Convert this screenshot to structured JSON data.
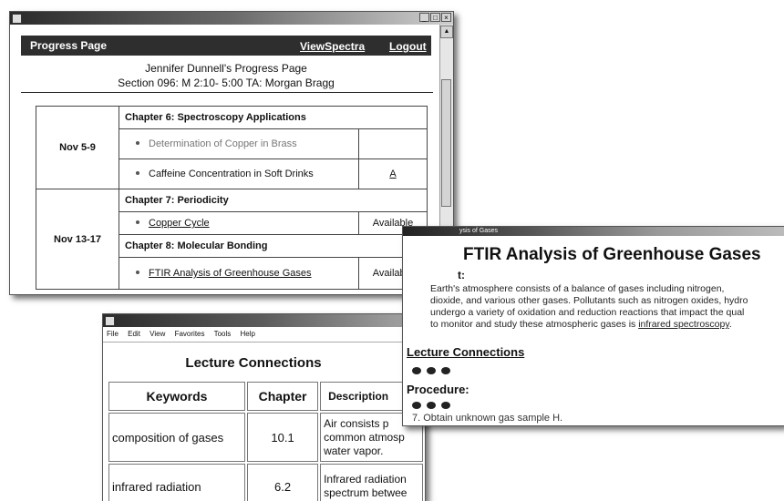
{
  "progress_window": {
    "nav": {
      "title": "Progress Page",
      "view_spectra": "ViewSpectra",
      "logout": "Logout"
    },
    "header_line1": "Jennifer Dunnell's Progress Page",
    "header_line2": "Section 096: M 2:10- 5:00   TA: Morgan Bragg",
    "rows": [
      {
        "date": "Nov 5-9",
        "chapter": "Chapter 6: Spectroscopy Applications",
        "experiments": [
          {
            "name": "Determination of Copper in Brass",
            "status": ""
          },
          {
            "name": "Caffeine Concentration in Soft Drinks",
            "status": "A"
          }
        ]
      },
      {
        "date": "Nov 13-17",
        "chapter": "Chapter 7: Periodicity",
        "experiments": [
          {
            "name": "Copper Cycle",
            "status": "Available"
          }
        ],
        "chapter2": "Chapter 8: Molecular Bonding",
        "experiments2": [
          {
            "name": "FTIR Analysis of Greenhouse Gases",
            "status": "Available"
          }
        ]
      }
    ]
  },
  "lecture_window": {
    "menu": [
      "File",
      "Edit",
      "View",
      "Favorites",
      "Tools",
      "Help"
    ],
    "title": "Lecture Connections",
    "headers": {
      "keywords": "Keywords",
      "chapter": "Chapter",
      "description": "Description"
    },
    "rows": [
      {
        "keyword": "composition of gases",
        "chapter": "10.1",
        "desc1": "Air consists p",
        "desc2": "common atmosp",
        "desc3": "water vapor."
      },
      {
        "keyword": "infrared radiation",
        "chapter": "6.2",
        "desc1": "Infrared radiation",
        "desc2": "spectrum betwee",
        "desc3": ""
      }
    ]
  },
  "ftir_window": {
    "titlebar": "ysis of Gases",
    "title": "FTIR Analysis of Greenhouse Gases",
    "abstract_label": "t:",
    "abstract_l1": "Earth's atmosphere consists of a balance of gases including nitrogen,",
    "abstract_l2": "dioxide, and various other gases. Pollutants such as nitrogen oxides, hydro",
    "abstract_l3": "undergo a variety of oxidation and reduction reactions that impact the qual",
    "abstract_l4a": "to monitor and study these atmospheric gases is ",
    "abstract_l4b": "infrared spectroscopy",
    "abstract_l4c": ".",
    "lecture_connections": "Lecture Connections",
    "procedure": "Procedure:",
    "step": "7.  Obtain unknown gas sample H."
  }
}
